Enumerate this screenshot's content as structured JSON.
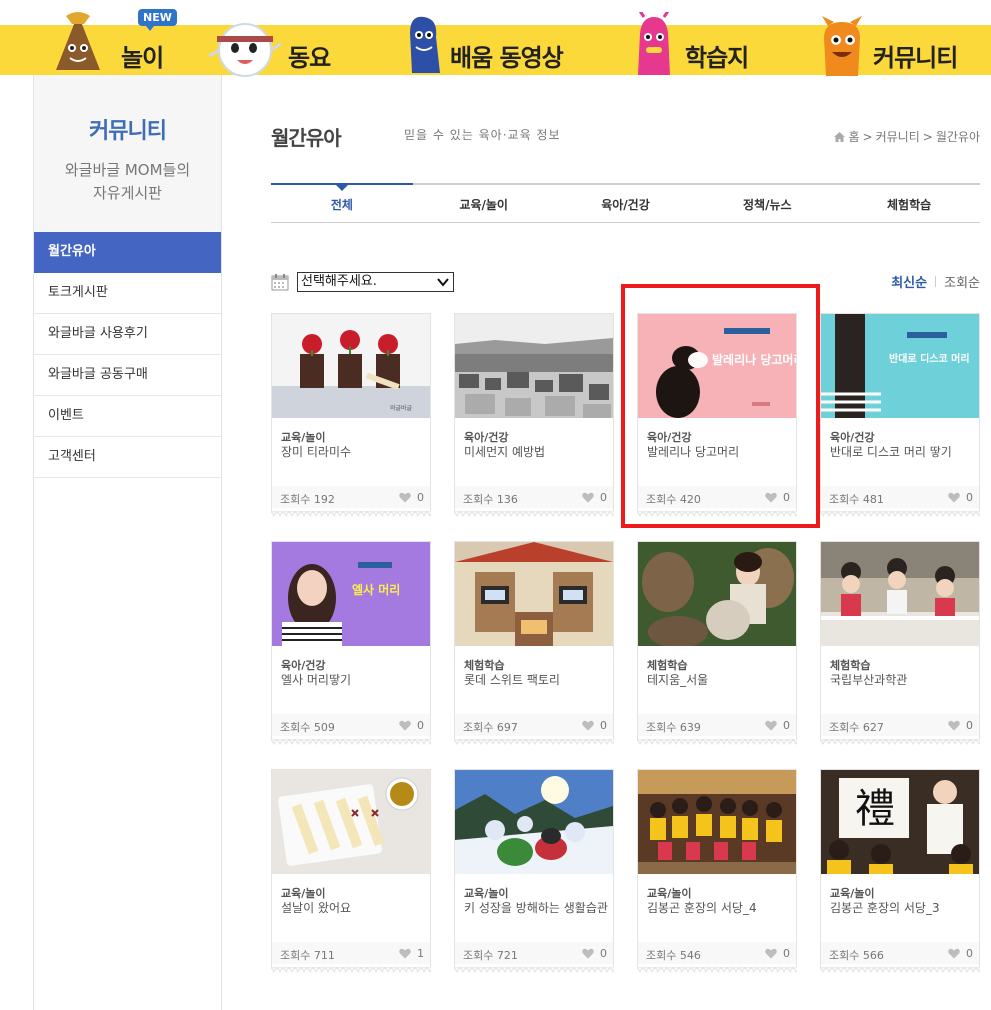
{
  "nav": {
    "new_badge": "NEW",
    "items": [
      {
        "label": "놀이"
      },
      {
        "label": "동요"
      },
      {
        "label": "배움 동영상"
      },
      {
        "label": "학습지"
      },
      {
        "label": "커뮤니티"
      }
    ]
  },
  "sidebar": {
    "title": "커뮤니티",
    "subtitle_line1": "와글바글 MOM들의",
    "subtitle_line2": "자유게시판",
    "items": [
      {
        "label": "월간유아"
      },
      {
        "label": "토크게시판"
      },
      {
        "label": "와글바글 사용후기"
      },
      {
        "label": "와글바글 공동구매"
      },
      {
        "label": "이벤트"
      },
      {
        "label": "고객센터"
      }
    ]
  },
  "header": {
    "title": "월간유아",
    "description": "믿을 수 있는 육아·교육 정보",
    "breadcrumb": [
      "홈",
      ">",
      "커뮤니티",
      ">",
      "월간유아"
    ]
  },
  "tabs": [
    {
      "label": "전체"
    },
    {
      "label": "교육/놀이"
    },
    {
      "label": "육아/건강"
    },
    {
      "label": "정책/뉴스"
    },
    {
      "label": "체험학습"
    }
  ],
  "filter": {
    "selected": "선택해주세요."
  },
  "sort": {
    "latest": "최신순",
    "views": "조회순"
  },
  "views_label": "조회수",
  "cards": [
    {
      "category": "교육/놀이",
      "title": "장미 티라미수",
      "views": "192",
      "likes": "0",
      "thumb_text": "와글바글"
    },
    {
      "category": "육아/건강",
      "title": "미세먼지 예방법",
      "views": "136",
      "likes": "0",
      "thumb_text": ""
    },
    {
      "category": "육아/건강",
      "title": "발레리나 당고머리",
      "views": "420",
      "likes": "0",
      "thumb_text": "발레리나 당고머리"
    },
    {
      "category": "육아/건강",
      "title": "반대로 디스코 머리 땋기",
      "views": "481",
      "likes": "0",
      "thumb_text": "반대로 디스코 머리"
    },
    {
      "category": "육아/건강",
      "title": "엘사 머리땋기",
      "views": "509",
      "likes": "0",
      "thumb_text": "엘사 머리"
    },
    {
      "category": "체험학습",
      "title": "롯데 스위트 팩토리",
      "views": "697",
      "likes": "0",
      "thumb_text": ""
    },
    {
      "category": "체험학습",
      "title": "테지움_서울",
      "views": "639",
      "likes": "0",
      "thumb_text": ""
    },
    {
      "category": "체험학습",
      "title": "국립부산과학관",
      "views": "627",
      "likes": "0",
      "thumb_text": ""
    },
    {
      "category": "교육/놀이",
      "title": "설날이 왔어요",
      "views": "711",
      "likes": "1",
      "thumb_text": ""
    },
    {
      "category": "교육/놀이",
      "title": "키 성장을 방해하는 생활습관",
      "views": "721",
      "likes": "0",
      "thumb_text": ""
    },
    {
      "category": "교육/놀이",
      "title": "김봉곤 훈장의 서당_4",
      "views": "546",
      "likes": "0",
      "thumb_text": ""
    },
    {
      "category": "교육/놀이",
      "title": "김봉곤 훈장의 서당_3",
      "views": "566",
      "likes": "0",
      "thumb_text": "禮"
    }
  ],
  "colors": {
    "nav_band": "#fcd93b",
    "sidebar_active": "#4466c2",
    "accent": "#2d5aa8",
    "highlight": "#ec1c1c"
  }
}
